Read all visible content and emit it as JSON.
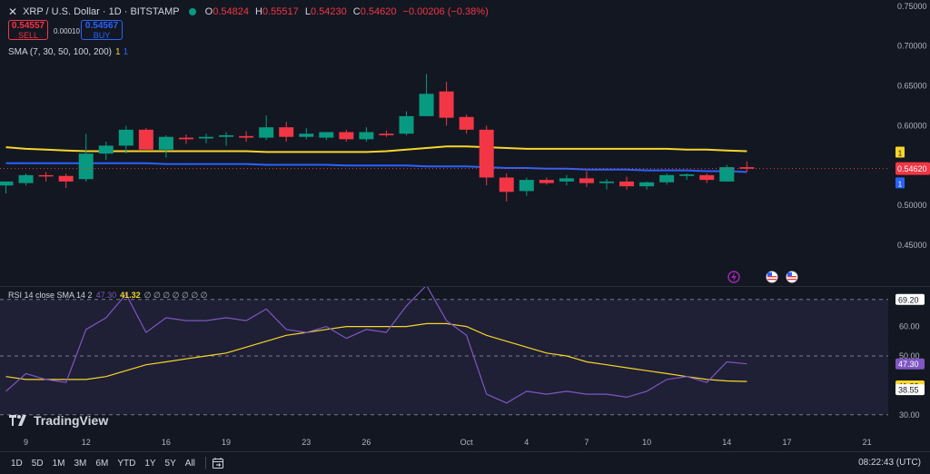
{
  "header": {
    "symbol": "XRP / U.S. Dollar · 1D · BITSTAMP",
    "ohlc": [
      {
        "k": "O",
        "v": "0.54824"
      },
      {
        "k": "H",
        "v": "0.55517"
      },
      {
        "k": "L",
        "v": "0.54230"
      },
      {
        "k": "C",
        "v": "0.54620"
      },
      {
        "k": "",
        "v": "−0.00206 (−0.38%)"
      }
    ],
    "sell_price": "0.54557",
    "sell_label": "SELL",
    "buy_price": "0.54567",
    "buy_label": "BUY",
    "spread": "0.00010"
  },
  "sma_legend": {
    "label": "SMA (7, 30, 50, 100, 200)",
    "v1": "1",
    "v2": "1"
  },
  "rsi_legend": {
    "label": "RSI 14 close SMA 14 2",
    "rsi": "47.30",
    "sma": "41.32",
    "zeros": "∅ ∅ ∅ ∅ ∅ ∅ ∅"
  },
  "brand": "TradingView",
  "timeframes": [
    "1D",
    "5D",
    "1M",
    "3M",
    "6M",
    "YTD",
    "1Y",
    "5Y",
    "All"
  ],
  "clock": "08:22:43 (UTC)",
  "colors": {
    "up": "#089981",
    "down": "#f23645",
    "sma_yellow": "#f7d52a",
    "sma_blue": "#2962ff",
    "rsi": "#7e57c2",
    "bg": "#131722"
  },
  "icons": [
    "x-close-icon",
    "status-dot-icon",
    "lightning-icon",
    "us-flag-icon",
    "calendar-range-icon",
    "tradingview-logo-icon"
  ],
  "price_axis": {
    "ticks": [
      "0.75000",
      "0.70000",
      "0.65000",
      "0.60000",
      "0.55000",
      "0.50000",
      "0.45000"
    ],
    "tick_values": [
      0.75,
      0.7,
      0.65,
      0.6,
      0.55,
      0.5,
      0.45
    ],
    "last_price": "0.54620",
    "sma_tag_yellow": "1",
    "sma_tag_blue": "1"
  },
  "rsi_axis": {
    "ticks": [
      "60.00",
      "50.00",
      "30.00"
    ],
    "tick_values": [
      60,
      50,
      30
    ],
    "upper_band": "69.20",
    "upper_band_value": 69.2,
    "lower_band_value": 30,
    "mid_value": 50,
    "rsi_label": "47.30",
    "rsi_value": 47.3,
    "sma_label": "41.32",
    "sma_value": 41.32,
    "low_label": "38.55",
    "low_value": 38.55
  },
  "time_axis": [
    {
      "label": "9",
      "index": 1
    },
    {
      "label": "12",
      "index": 4
    },
    {
      "label": "16",
      "index": 8
    },
    {
      "label": "19",
      "index": 11
    },
    {
      "label": "23",
      "index": 15
    },
    {
      "label": "26",
      "index": 18
    },
    {
      "label": "Oct",
      "index": 23
    },
    {
      "label": "4",
      "index": 26
    },
    {
      "label": "7",
      "index": 29
    },
    {
      "label": "10",
      "index": 32
    },
    {
      "label": "14",
      "index": 36
    },
    {
      "label": "17",
      "index": 39
    },
    {
      "label": "21",
      "index": 43
    }
  ],
  "chart_data": {
    "type": "candlestick",
    "ylim": [
      0.4,
      0.76
    ],
    "candles": [
      {
        "o": 0.525,
        "h": 0.53,
        "l": 0.515,
        "c": 0.53
      },
      {
        "o": 0.528,
        "h": 0.54,
        "l": 0.525,
        "c": 0.538
      },
      {
        "o": 0.538,
        "h": 0.542,
        "l": 0.53,
        "c": 0.537
      },
      {
        "o": 0.537,
        "h": 0.54,
        "l": 0.522,
        "c": 0.53
      },
      {
        "o": 0.533,
        "h": 0.59,
        "l": 0.53,
        "c": 0.565
      },
      {
        "o": 0.565,
        "h": 0.58,
        "l": 0.557,
        "c": 0.575
      },
      {
        "o": 0.575,
        "h": 0.6,
        "l": 0.565,
        "c": 0.595
      },
      {
        "o": 0.595,
        "h": 0.597,
        "l": 0.57,
        "c": 0.57
      },
      {
        "o": 0.57,
        "h": 0.588,
        "l": 0.56,
        "c": 0.586
      },
      {
        "o": 0.585,
        "h": 0.589,
        "l": 0.577,
        "c": 0.583
      },
      {
        "o": 0.584,
        "h": 0.59,
        "l": 0.578,
        "c": 0.586
      },
      {
        "o": 0.586,
        "h": 0.592,
        "l": 0.575,
        "c": 0.588
      },
      {
        "o": 0.587,
        "h": 0.593,
        "l": 0.58,
        "c": 0.585
      },
      {
        "o": 0.585,
        "h": 0.613,
        "l": 0.582,
        "c": 0.598
      },
      {
        "o": 0.598,
        "h": 0.605,
        "l": 0.58,
        "c": 0.586
      },
      {
        "o": 0.586,
        "h": 0.597,
        "l": 0.583,
        "c": 0.59
      },
      {
        "o": 0.585,
        "h": 0.592,
        "l": 0.582,
        "c": 0.592
      },
      {
        "o": 0.592,
        "h": 0.595,
        "l": 0.58,
        "c": 0.583
      },
      {
        "o": 0.583,
        "h": 0.598,
        "l": 0.58,
        "c": 0.592
      },
      {
        "o": 0.59,
        "h": 0.594,
        "l": 0.586,
        "c": 0.588
      },
      {
        "o": 0.59,
        "h": 0.618,
        "l": 0.588,
        "c": 0.612
      },
      {
        "o": 0.612,
        "h": 0.665,
        "l": 0.612,
        "c": 0.64
      },
      {
        "o": 0.643,
        "h": 0.655,
        "l": 0.6,
        "c": 0.61
      },
      {
        "o": 0.611,
        "h": 0.614,
        "l": 0.59,
        "c": 0.595
      },
      {
        "o": 0.595,
        "h": 0.6,
        "l": 0.525,
        "c": 0.535
      },
      {
        "o": 0.535,
        "h": 0.54,
        "l": 0.505,
        "c": 0.517
      },
      {
        "o": 0.518,
        "h": 0.535,
        "l": 0.512,
        "c": 0.532
      },
      {
        "o": 0.532,
        "h": 0.535,
        "l": 0.526,
        "c": 0.528
      },
      {
        "o": 0.53,
        "h": 0.538,
        "l": 0.525,
        "c": 0.534
      },
      {
        "o": 0.534,
        "h": 0.543,
        "l": 0.523,
        "c": 0.528
      },
      {
        "o": 0.528,
        "h": 0.533,
        "l": 0.52,
        "c": 0.53
      },
      {
        "o": 0.53,
        "h": 0.536,
        "l": 0.52,
        "c": 0.524
      },
      {
        "o": 0.524,
        "h": 0.53,
        "l": 0.52,
        "c": 0.529
      },
      {
        "o": 0.529,
        "h": 0.54,
        "l": 0.526,
        "c": 0.538
      },
      {
        "o": 0.537,
        "h": 0.54,
        "l": 0.532,
        "c": 0.539
      },
      {
        "o": 0.538,
        "h": 0.54,
        "l": 0.528,
        "c": 0.532
      },
      {
        "o": 0.53,
        "h": 0.551,
        "l": 0.53,
        "c": 0.548
      },
      {
        "o": 0.548,
        "h": 0.555,
        "l": 0.542,
        "c": 0.546
      }
    ],
    "sma_yellow": [
      0.573,
      0.571,
      0.57,
      0.569,
      0.568,
      0.568,
      0.568,
      0.568,
      0.568,
      0.568,
      0.568,
      0.568,
      0.568,
      0.567,
      0.567,
      0.567,
      0.567,
      0.567,
      0.567,
      0.568,
      0.57,
      0.572,
      0.574,
      0.574,
      0.573,
      0.572,
      0.571,
      0.571,
      0.571,
      0.571,
      0.571,
      0.571,
      0.571,
      0.571,
      0.57,
      0.57,
      0.569,
      0.568
    ],
    "sma_blue": [
      0.553,
      0.553,
      0.553,
      0.553,
      0.553,
      0.553,
      0.553,
      0.553,
      0.552,
      0.552,
      0.552,
      0.552,
      0.552,
      0.551,
      0.551,
      0.551,
      0.551,
      0.55,
      0.55,
      0.55,
      0.55,
      0.549,
      0.549,
      0.549,
      0.548,
      0.547,
      0.547,
      0.546,
      0.546,
      0.545,
      0.545,
      0.545,
      0.544,
      0.544,
      0.544,
      0.543,
      0.543,
      0.542
    ],
    "rsi": [
      38,
      44,
      42,
      41,
      59,
      63,
      71,
      58,
      63,
      62,
      62,
      63,
      62,
      66,
      59,
      58,
      60,
      56,
      59,
      58,
      67,
      74,
      62,
      57,
      37,
      34,
      38,
      37,
      38,
      37,
      37,
      36,
      38,
      42,
      43,
      41,
      48,
      47.3
    ],
    "rsi_sma": [
      43,
      42,
      42,
      42,
      42,
      43,
      45,
      47,
      48,
      49,
      50,
      51,
      53,
      55,
      57,
      58,
      59,
      60,
      60,
      60,
      60,
      61,
      61,
      60,
      57,
      55,
      53,
      51,
      50,
      48,
      47,
      46,
      45,
      44,
      43,
      42,
      41.5,
      41.32
    ],
    "rsi_ylim": [
      25,
      75
    ]
  }
}
